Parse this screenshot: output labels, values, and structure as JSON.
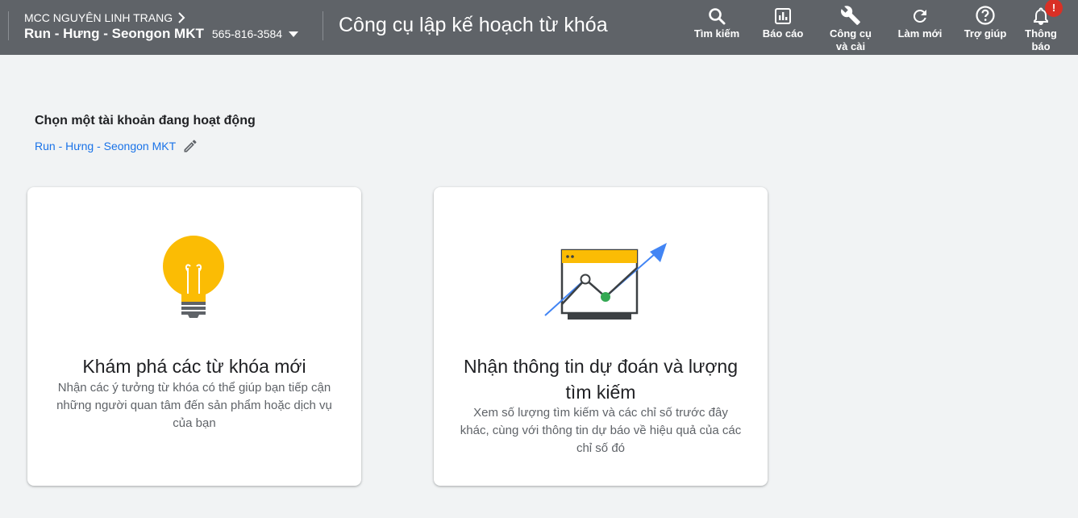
{
  "header": {
    "mcc": "MCC NGUYÊN LINH TRANG",
    "account_name": "Run - Hưng - Seongon MKT",
    "account_id": "565-816-3584",
    "page_title": "Công cụ lập kế hoạch từ khóa",
    "nav": [
      {
        "label": "Tìm kiếm",
        "icon": "search-icon"
      },
      {
        "label": "Báo cáo",
        "icon": "reports-icon"
      },
      {
        "label": "Công cụ và cài",
        "icon": "wrench-icon"
      },
      {
        "label": "Làm mới",
        "icon": "refresh-icon"
      },
      {
        "label": "Trợ giúp",
        "icon": "help-icon"
      },
      {
        "label": "Thông báo",
        "icon": "bell-icon",
        "badge": "!"
      }
    ]
  },
  "main": {
    "section_title": "Chọn một tài khoản đang hoạt động",
    "active_account": "Run - Hưng - Seongon MKT",
    "cards": [
      {
        "title": "Khám phá các từ khóa mới",
        "description": "Nhận các ý tưởng từ khóa có thể giúp bạn tiếp cận những người quan tâm đến sản phẩm hoặc dịch vụ của bạn"
      },
      {
        "title": "Nhận thông tin dự đoán và lượng tìm kiếm",
        "description": "Xem số lượng tìm kiếm và các chỉ số trước đây khác, cùng với thông tin dự báo về hiệu quả của các chỉ số đó"
      }
    ]
  },
  "colors": {
    "topbar": "#5f6368",
    "link": "#1a73e8",
    "bulb": "#fbbc04",
    "green": "#34a853",
    "arrow": "#4285f4",
    "badge": "#d93025"
  }
}
